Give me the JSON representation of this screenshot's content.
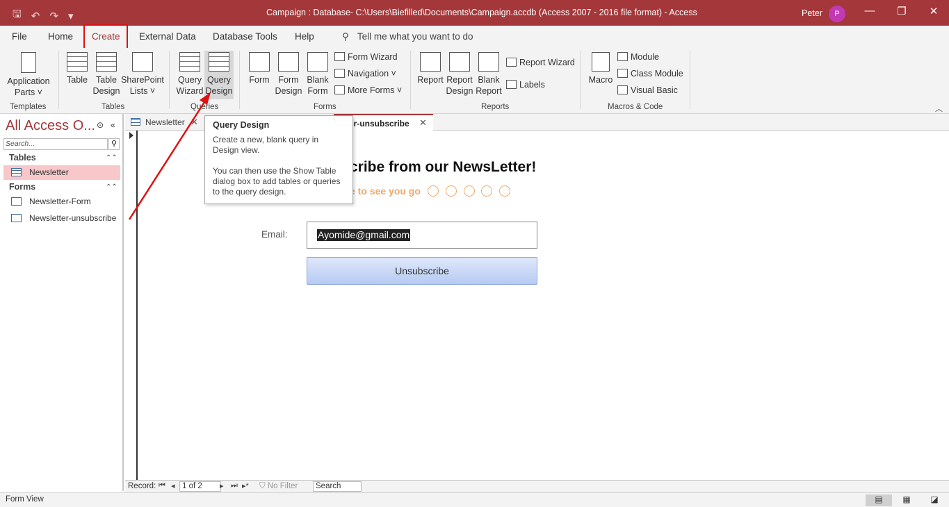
{
  "titlebar": {
    "title": "Campaign : Database- C:\\Users\\Biefilled\\Documents\\Campaign.accdb (Access 2007 - 2016 file format)  -  Access",
    "user": "Peter",
    "avatar_initial": "P",
    "qat": {
      "save_icon": "save-icon",
      "undo_icon": "undo-icon",
      "redo_icon": "redo-icon",
      "customize_icon": "customize-qat-icon"
    },
    "controls": {
      "minimize": "—",
      "restore": "❐",
      "close": "✕"
    }
  },
  "menu": {
    "tabs": [
      "File",
      "Home",
      "Create",
      "External Data",
      "Database Tools",
      "Help"
    ],
    "active": "Create",
    "tell_me": "Tell me what you want to do"
  },
  "ribbon": {
    "templates": {
      "label": "Templates",
      "app_parts": [
        "Application",
        "Parts ˅"
      ]
    },
    "tables": {
      "label": "Tables",
      "table": "Table",
      "table_design": [
        "Table",
        "Design"
      ],
      "sharepoint": [
        "SharePoint",
        "Lists ˅"
      ]
    },
    "queries": {
      "label": "Queries",
      "wizard": [
        "Query",
        "Wizard"
      ],
      "design": [
        "Query",
        "Design"
      ]
    },
    "forms": {
      "label": "Forms",
      "form": "Form",
      "form_design": [
        "Form",
        "Design"
      ],
      "blank_form": [
        "Blank",
        "Form"
      ],
      "form_wizard": "Form Wizard",
      "navigation": "Navigation ˅",
      "more_forms": "More Forms ˅"
    },
    "reports": {
      "label": "Reports",
      "report": "Report",
      "report_design": [
        "Report",
        "Design"
      ],
      "blank_report": [
        "Blank",
        "Report"
      ],
      "report_wizard": "Report Wizard",
      "labels": "Labels"
    },
    "macros": {
      "label": "Macros & Code",
      "macro": "Macro",
      "module": "Module",
      "class_module": "Class Module",
      "visual_basic": "Visual Basic"
    }
  },
  "tooltip": {
    "title": "Query Design",
    "line1": "Create a new, blank query in Design view.",
    "line2": "You can then use the Show Table dialog box to add tables or queries to the query design."
  },
  "navpane": {
    "title": "All Access O...",
    "search_placeholder": "Search...",
    "sections": [
      {
        "name": "Tables",
        "items": [
          "Newsletter"
        ]
      },
      {
        "name": "Forms",
        "items": [
          "Newsletter-Form",
          "Newsletter-unsubscribe"
        ]
      }
    ],
    "selected": "Newsletter"
  },
  "doc_tabs": [
    {
      "label": "Newsletter",
      "active": false
    },
    {
      "label": "tter-unsubscribe",
      "active": true
    }
  ],
  "form": {
    "title": "cribe from our NewsLetter!",
    "subtitle": "e to see you go",
    "email_label": "Email:",
    "email_value": "Ayomide@gmail.com",
    "button": "Unsubscribe"
  },
  "record_nav": {
    "label": "Record:",
    "position": "1 of 2",
    "filter": "No Filter",
    "search": "Search"
  },
  "status": {
    "text": "Form View"
  },
  "colors": {
    "accent": "#a4373a",
    "highlight": "#e01010",
    "subtitle": "#f0a868",
    "selected_item": "#f7c7c9"
  }
}
